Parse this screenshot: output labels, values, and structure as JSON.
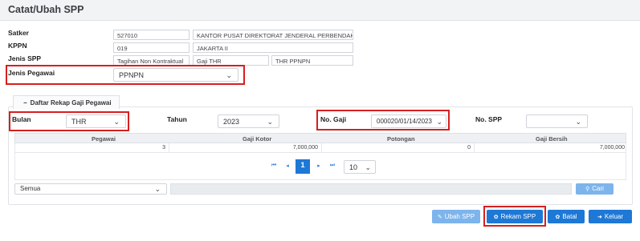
{
  "header": {
    "title": "Catat/Ubah SPP"
  },
  "form": {
    "satker": {
      "label": "Satker",
      "code": "527010",
      "name": "KANTOR PUSAT DIREKTORAT JENDERAL PERBENDAHARA..."
    },
    "kppn": {
      "label": "KPPN",
      "code": "019",
      "name": "JAKARTA II"
    },
    "jenis_spp": {
      "label": "Jenis SPP",
      "value1": "Tagihan Non Kontraktual",
      "value2": "Gaji THR",
      "value3": "THR PPNPN"
    },
    "jenis_pegawai": {
      "label": "Jenis Pegawai",
      "value": "PPNPN"
    }
  },
  "tab": {
    "label": "Daftar Rekap Gaji Pegawai",
    "icon": "minus-icon"
  },
  "filters": {
    "bulan": {
      "label": "Bulan",
      "value": "THR"
    },
    "tahun": {
      "label": "Tahun",
      "value": "2023"
    },
    "no_gaji": {
      "label": "No. Gaji",
      "value": "000020/01/14/2023"
    },
    "no_spp": {
      "label": "No. SPP",
      "value": ""
    }
  },
  "grid": {
    "columns": [
      "Pegawai",
      "Gaji Kotor",
      "Potongan",
      "Gaji Bersih"
    ],
    "rows": [
      {
        "pegawai": "3",
        "gaji_kotor": "7,000,000",
        "potongan": "0",
        "gaji_bersih": "7,000,000"
      }
    ]
  },
  "pagination": {
    "first": "⏮",
    "prev": "◂",
    "page": "1",
    "next": "▸",
    "last": "⏭",
    "page_size": "10"
  },
  "search": {
    "scope": "Semua",
    "query": "",
    "button": "Cari"
  },
  "actions": {
    "ubah": "Ubah SPP",
    "rekam": "Rekam SPP",
    "batal": "Batal",
    "keluar": "Keluar"
  },
  "colors": {
    "primary": "#1d78d6",
    "primary_light": "#7db4ec",
    "highlight": "#d6201f"
  }
}
